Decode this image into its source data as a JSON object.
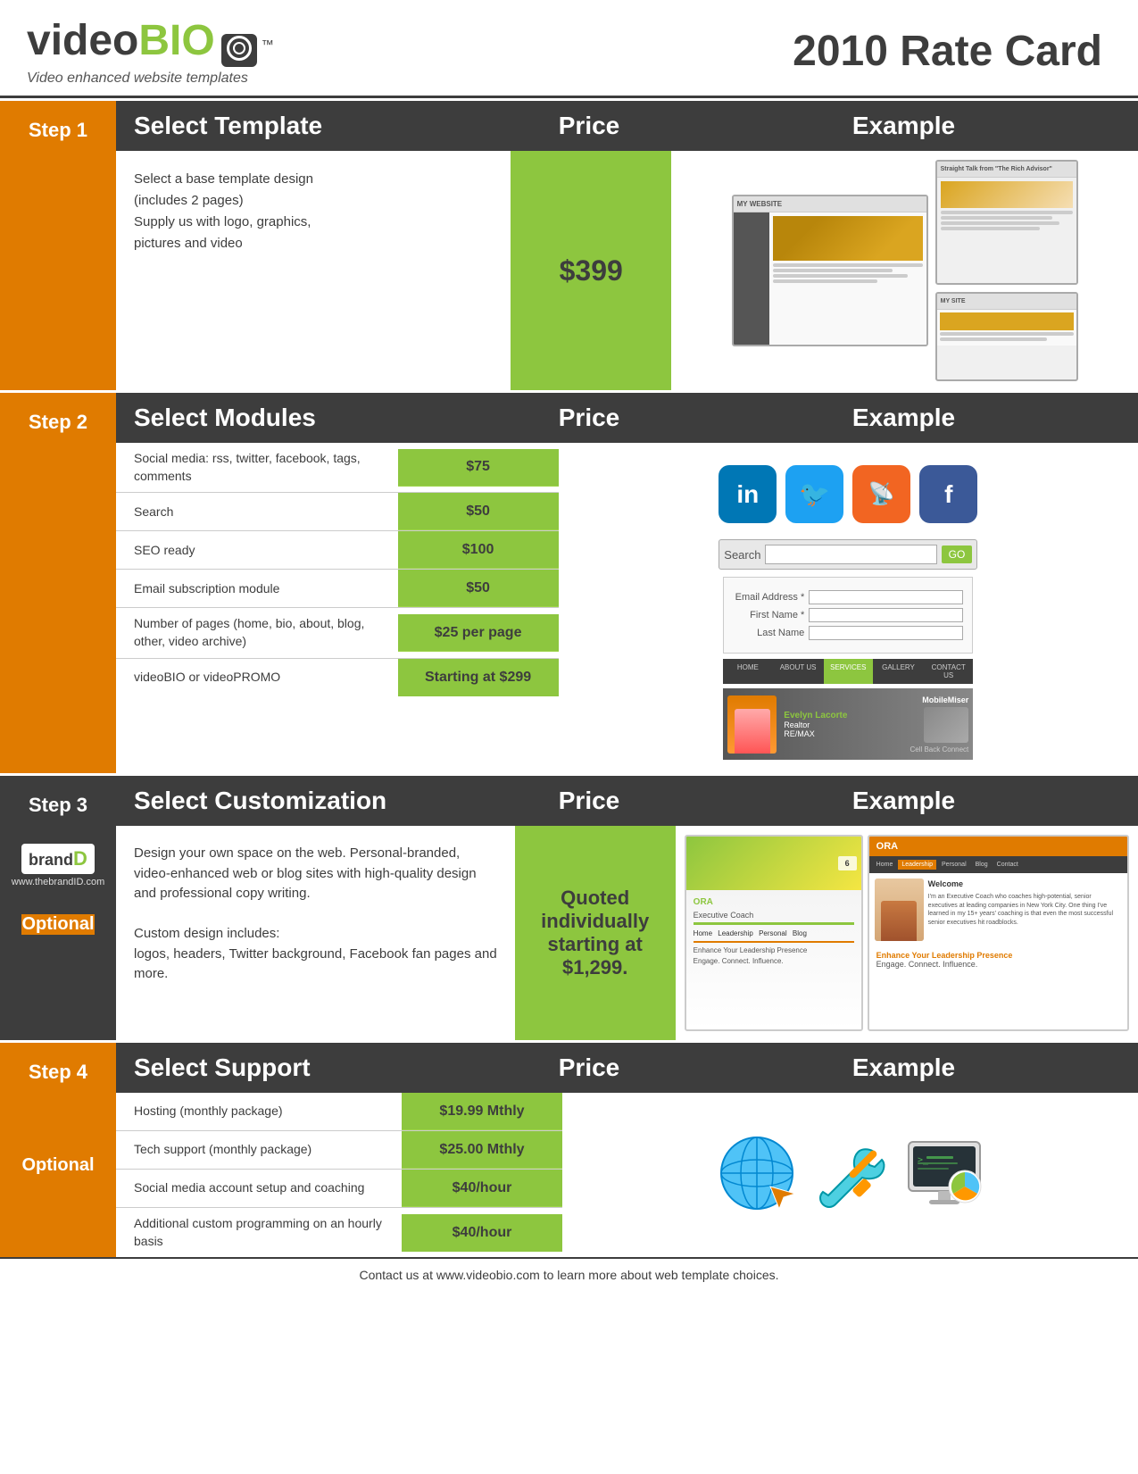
{
  "header": {
    "logo_video": "video",
    "logo_bio": "BIO",
    "logo_tm": "™",
    "tagline": "Video enhanced website templates",
    "rate_card_title": "2010 Rate Card"
  },
  "step1": {
    "step_label": "Step 1",
    "col_title": "Select Template",
    "col_price": "Price",
    "col_example": "Example",
    "description_line1": "Select a base template design",
    "description_line2": "(includes 2 pages)",
    "description_line3": "Supply us with logo, graphics,",
    "description_line4": "pictures and video",
    "price": "$399"
  },
  "step2": {
    "step_label": "Step 2",
    "col_title": "Select Modules",
    "col_price": "Price",
    "col_example": "Example",
    "items": [
      {
        "label": "Social media: rss, twitter, facebook, tags, comments",
        "price": "$75"
      },
      {
        "label": "Search",
        "price": "$50"
      },
      {
        "label": "SEO ready",
        "price": "$100"
      },
      {
        "label": "Email subscription module",
        "price": "$50"
      },
      {
        "label": "Number of pages (home, bio, about, blog, other, video archive)",
        "price": "$25 per page"
      },
      {
        "label": "videoBIO or videoPROMO",
        "price": "Starting at $299"
      }
    ]
  },
  "step3": {
    "step_label": "Step 3",
    "optional_label": "Optional",
    "brand_name": "brand",
    "brand_d": "D",
    "brand_url": "www.thebrandID.com",
    "col_title": "Select Customization",
    "col_price": "Price",
    "col_example": "Example",
    "description": "Design your own space on the web. Personal-branded, video-enhanced web or blog sites with high-quality design and professional copy writing.",
    "custom_includes_label": "Custom design includes:",
    "custom_includes_detail": "logos, headers, Twitter background, Facebook fan pages and more.",
    "price": "Quoted individually starting at $1,299."
  },
  "step4": {
    "step_label": "Step 4",
    "optional_label": "Optional",
    "col_title": "Select Support",
    "col_price": "Price",
    "col_example": "Example",
    "items": [
      {
        "label": "Hosting (monthly package)",
        "price": "$19.99 Mthly"
      },
      {
        "label": "Tech support (monthly package)",
        "price": "$25.00 Mthly"
      },
      {
        "label": "Social media account setup and coaching",
        "price": "$40/hour"
      },
      {
        "label": "Additional custom programming on an hourly basis",
        "price": "$40/hour"
      }
    ]
  },
  "footer": {
    "text": "Contact us at www.videobio.com to learn more about web template choices."
  },
  "nav_items": [
    "HOME",
    "ABOUT US",
    "SERVICES",
    "GALLERY",
    "CONTACT US"
  ],
  "search_placeholder": "Search"
}
